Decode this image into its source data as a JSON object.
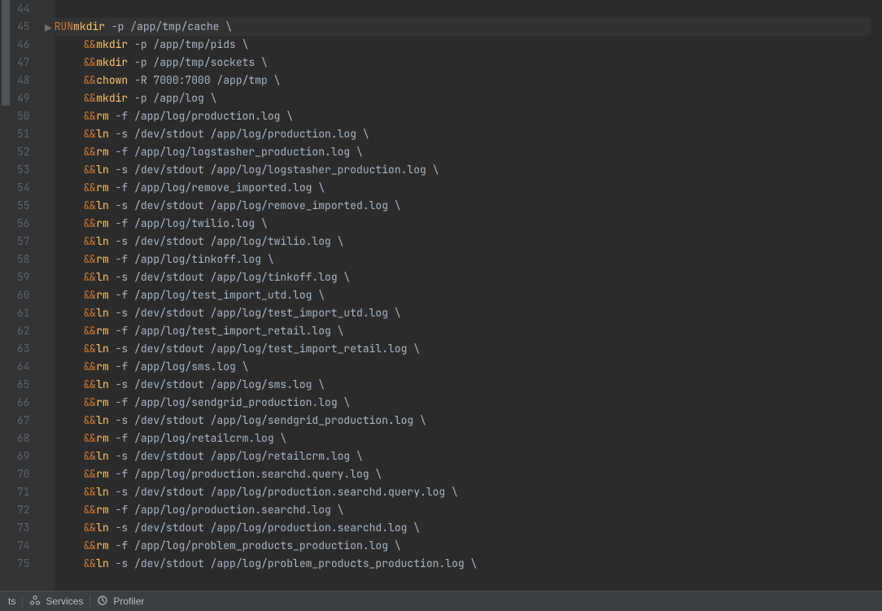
{
  "colors": {
    "keyword": "#cc7832",
    "command": "#ffc66d",
    "text": "#a9b7c6",
    "gutter": "#606366"
  },
  "gutter": {
    "start": 44,
    "end": 75,
    "current": 45
  },
  "lines": {
    "l44": "",
    "l45_kw": "RUN",
    "l45_cmd": "mkdir",
    "l45_rest": " -p /app/tmp/cache \\",
    "l46_op": "&&",
    "l46_cmd": "mkdir",
    "l46_rest": " -p /app/tmp/pids \\",
    "l47_op": "&&",
    "l47_cmd": "mkdir",
    "l47_rest": " -p /app/tmp/sockets \\",
    "l48_op": "&&",
    "l48_cmd": "chown",
    "l48_rest": " -R 7000:7000 /app/tmp \\",
    "l49_op": "&&",
    "l49_cmd": "mkdir",
    "l49_rest": " -p /app/log \\",
    "l50_op": "&&",
    "l50_cmd": "rm",
    "l50_rest": " -f /app/log/production.log \\",
    "l51_op": "&&",
    "l51_cmd": "ln",
    "l51_rest": " -s /dev/stdout /app/log/production.log \\",
    "l52_op": "&&",
    "l52_cmd": "rm",
    "l52_rest": " -f /app/log/logstasher_production.log \\",
    "l53_op": "&&",
    "l53_cmd": "ln",
    "l53_rest": " -s /dev/stdout /app/log/logstasher_production.log \\",
    "l54_op": "&&",
    "l54_cmd": "rm",
    "l54_rest": " -f /app/log/remove_imported.log \\",
    "l55_op": "&&",
    "l55_cmd": "ln",
    "l55_rest": " -s /dev/stdout /app/log/remove_imported.log \\",
    "l56_op": "&&",
    "l56_cmd": "rm",
    "l56_rest": " -f /app/log/twilio.log \\",
    "l57_op": "&&",
    "l57_cmd": "ln",
    "l57_rest": " -s /dev/stdout /app/log/twilio.log \\",
    "l58_op": "&&",
    "l58_cmd": "rm",
    "l58_rest": " -f /app/log/tinkoff.log \\",
    "l59_op": "&&",
    "l59_cmd": "ln",
    "l59_rest": " -s /dev/stdout /app/log/tinkoff.log \\",
    "l60_op": "&&",
    "l60_cmd": "rm",
    "l60_rest": " -f /app/log/test_import_utd.log \\",
    "l61_op": "&&",
    "l61_cmd": "ln",
    "l61_rest": " -s /dev/stdout /app/log/test_import_utd.log \\",
    "l62_op": "&&",
    "l62_cmd": "rm",
    "l62_rest": " -f /app/log/test_import_retail.log \\",
    "l63_op": "&&",
    "l63_cmd": "ln",
    "l63_rest": " -s /dev/stdout /app/log/test_import_retail.log \\",
    "l64_op": "&&",
    "l64_cmd": "rm",
    "l64_rest": " -f /app/log/sms.log \\",
    "l65_op": "&&",
    "l65_cmd": "ln",
    "l65_rest": " -s /dev/stdout /app/log/sms.log \\",
    "l66_op": "&&",
    "l66_cmd": "rm",
    "l66_rest": " -f /app/log/sendgrid_production.log \\",
    "l67_op": "&&",
    "l67_cmd": "ln",
    "l67_rest": " -s /dev/stdout /app/log/sendgrid_production.log \\",
    "l68_op": "&&",
    "l68_cmd": "rm",
    "l68_rest": " -f /app/log/retailcrm.log \\",
    "l69_op": "&&",
    "l69_cmd": "ln",
    "l69_rest": " -s /dev/stdout /app/log/retailcrm.log \\",
    "l70_op": "&&",
    "l70_cmd": "rm",
    "l70_rest": " -f /app/log/production.searchd.query.log \\",
    "l71_op": "&&",
    "l71_cmd": "ln",
    "l71_rest": " -s /dev/stdout /app/log/production.searchd.query.log \\",
    "l72_op": "&&",
    "l72_cmd": "rm",
    "l72_rest": " -f /app/log/production.searchd.log \\",
    "l73_op": "&&",
    "l73_cmd": "ln",
    "l73_rest": " -s /dev/stdout /app/log/production.searchd.log \\",
    "l74_op": "&&",
    "l74_cmd": "rm",
    "l74_rest": " -f /app/log/problem_products_production.log \\",
    "l75_op": "&&",
    "l75_cmd": "ln",
    "l75_rest": " -s /dev/stdout /app/log/problem_products_production.log \\"
  },
  "statusbar": {
    "item0": "ts",
    "services": "Services",
    "profiler": "Profiler"
  }
}
